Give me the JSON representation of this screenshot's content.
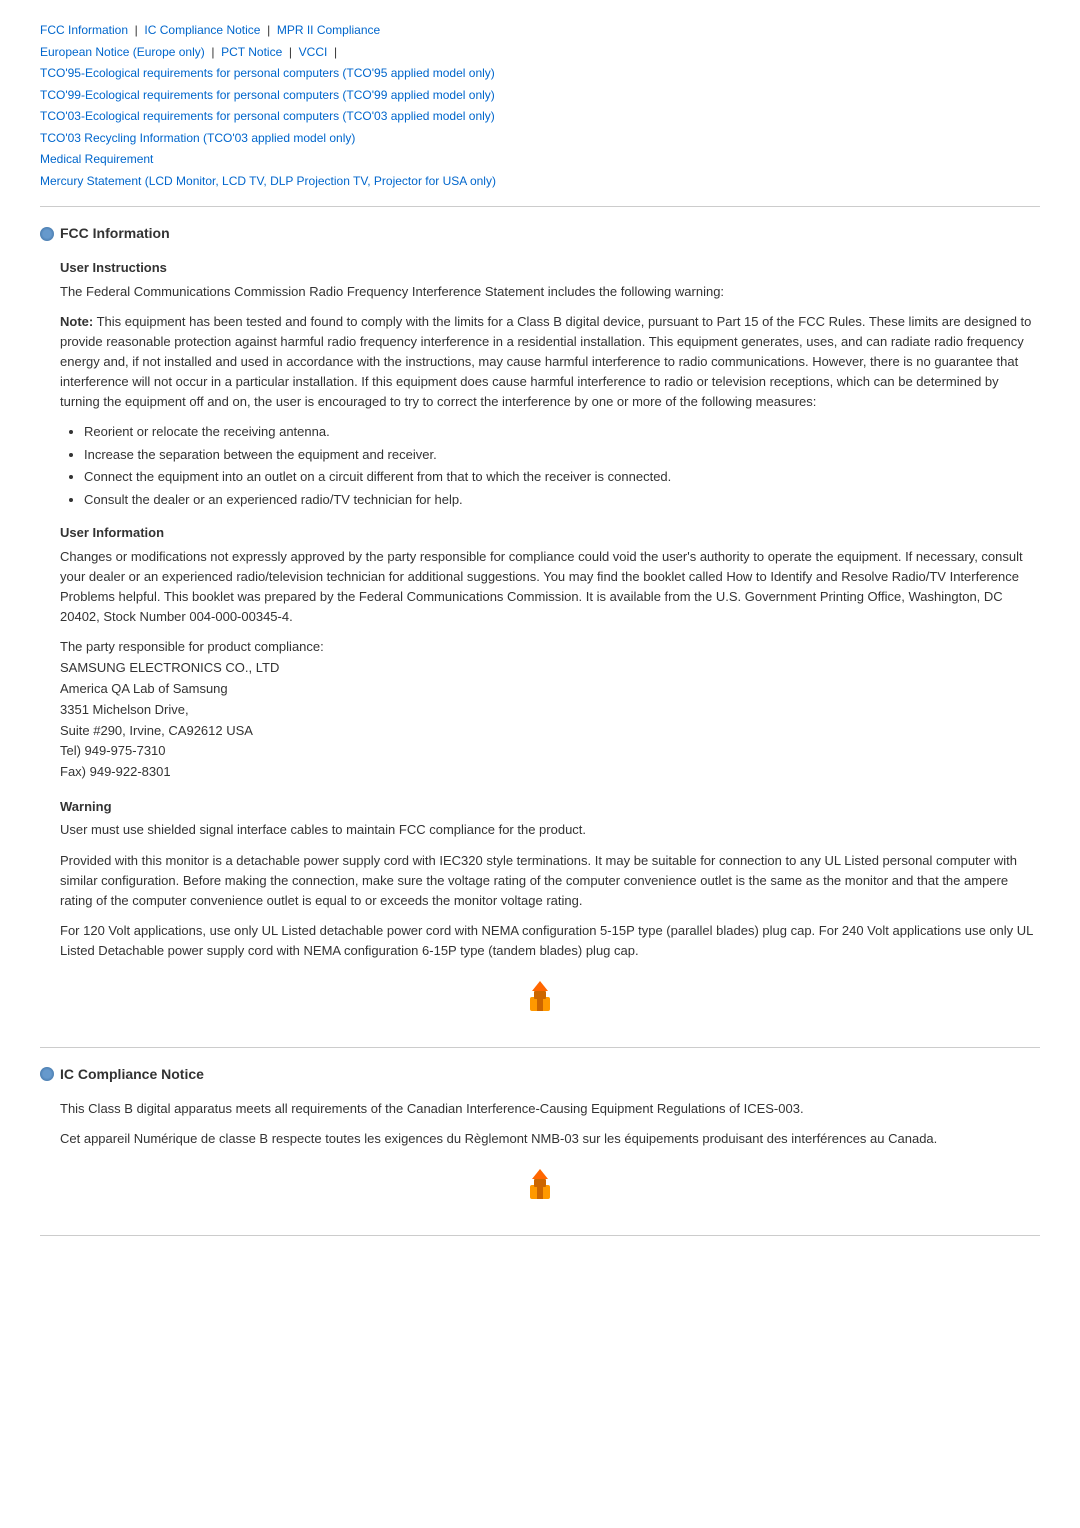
{
  "nav": {
    "links": [
      {
        "label": "FCC Information",
        "id": "fcc-info"
      },
      {
        "label": "IC Compliance Notice",
        "id": "ic-compliance"
      },
      {
        "label": "MPR II Compliance",
        "id": "mpr-compliance"
      },
      {
        "label": "European Notice (Europe only)",
        "id": "european-notice"
      },
      {
        "label": "PCT Notice",
        "id": "pct-notice"
      },
      {
        "label": "VCCI",
        "id": "vcci"
      },
      {
        "label": "TCO'95-Ecological requirements for personal computers (TCO'95 applied model only)",
        "id": "tco95"
      },
      {
        "label": "TCO'99-Ecological requirements for personal computers (TCO'99 applied model only)",
        "id": "tco99"
      },
      {
        "label": "TCO'03-Ecological requirements for personal computers (TCO'03 applied model only)",
        "id": "tco03"
      },
      {
        "label": "TCO'03 Recycling Information (TCO'03 applied model only)",
        "id": "tco03-recycling"
      },
      {
        "label": "Medical Requirement",
        "id": "medical"
      },
      {
        "label": "Mercury Statement (LCD Monitor, LCD TV, DLP Projection TV, Projector for USA only)",
        "id": "mercury"
      }
    ]
  },
  "sections": {
    "fcc": {
      "title": "FCC Information",
      "user_instructions": {
        "heading": "User Instructions",
        "para1": "The Federal Communications Commission Radio Frequency Interference Statement includes the following warning:",
        "note_label": "Note:",
        "note_text": " This equipment has been tested and found to comply with the limits for a Class B digital device, pursuant to Part 15 of the FCC Rules. These limits are designed to provide reasonable protection against harmful radio frequency interference in a residential installation. This equipment generates, uses, and can radiate radio frequency energy and, if not installed and used in accordance with the instructions, may cause harmful interference to radio communications. However, there is no guarantee that interference will not occur in a particular installation. If this equipment does cause harmful interference to radio or television receptions, which can be determined by turning the equipment off and on, the user is encouraged to try to correct the interference by one or more of the following measures:",
        "measures": [
          "Reorient or relocate the receiving antenna.",
          "Increase the separation between the equipment and receiver.",
          "Connect the equipment into an outlet on a circuit different from that to which the receiver is connected.",
          "Consult the dealer or an experienced radio/TV technician for help."
        ]
      },
      "user_information": {
        "heading": "User Information",
        "para1": "Changes or modifications not expressly approved by the party responsible for compliance could void the user's authority to operate the equipment. If necessary, consult your dealer or an experienced radio/television technician for additional suggestions. You may find the booklet called How to Identify and Resolve Radio/TV Interference Problems helpful. This booklet was prepared by the Federal Communications Commission. It is available from the U.S. Government Printing Office, Washington, DC 20402, Stock Number 004-000-00345-4.",
        "party_label": "The party responsible for product compliance:",
        "address": [
          "SAMSUNG ELECTRONICS CO., LTD",
          "America QA Lab of Samsung",
          "3351 Michelson Drive,",
          "Suite #290, Irvine, CA92612 USA",
          "Tel) 949-975-7310",
          "Fax) 949-922-8301"
        ]
      },
      "warning": {
        "heading": "Warning",
        "para1": "User must use shielded signal interface cables to maintain FCC compliance for the product.",
        "para2": "Provided with this monitor is a detachable power supply cord with IEC320 style terminations. It may be suitable for connection to any UL Listed personal computer with similar configuration. Before making the connection, make sure the voltage rating of the computer convenience outlet is the same as the monitor and that the ampere rating of the computer convenience outlet is equal to or exceeds the monitor voltage rating.",
        "para3": "For 120 Volt applications, use only UL Listed detachable power cord with NEMA configuration 5-15P type (parallel blades) plug cap. For 240 Volt applications use only UL Listed Detachable power supply cord with NEMA configuration 6-15P type (tandem blades) plug cap."
      }
    },
    "ic": {
      "title": "IC Compliance Notice",
      "para1": "This Class B digital apparatus meets all requirements of the Canadian Interference-Causing Equipment Regulations of ICES-003.",
      "para2": "Cet appareil Numérique de classe B respecte toutes les exigences du Règlemont NMB-03 sur les équipements produisant des interférences au Canada."
    }
  },
  "top_button_label": "Top"
}
